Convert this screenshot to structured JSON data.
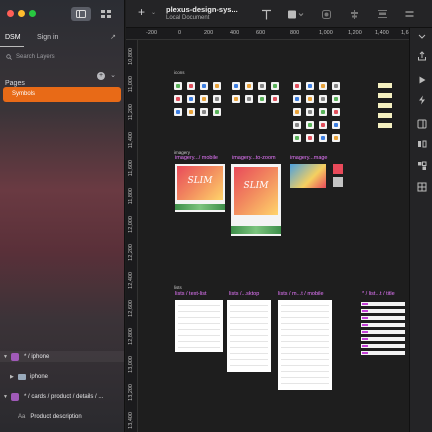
{
  "window": {
    "traffic_lights": [
      "#ff5f57",
      "#febc2e",
      "#28c840"
    ]
  },
  "sidebar": {
    "tabs": [
      "DSM",
      "Sign in"
    ],
    "search_placeholder": "Search Layers",
    "pages_label": "Pages",
    "selected_page": "Symbols",
    "accent": "#e86a17",
    "layers": [
      {
        "name": "* / iphone",
        "kind": "symbol"
      },
      {
        "name": "iphone",
        "kind": "folder"
      },
      {
        "name": "* / cards / product / details / ...",
        "kind": "symbol"
      },
      {
        "name": "Product description",
        "kind": "text"
      }
    ]
  },
  "toolbar": {
    "doc_title": "plexus-design-sys...",
    "doc_subtitle": "Local Document"
  },
  "ruler": {
    "x": [
      "-200",
      "0",
      "200",
      "400",
      "600",
      "800",
      "1,000",
      "1,200",
      "1,400",
      "1,6"
    ],
    "y": [
      "10,800",
      "11,000",
      "11,200",
      "11,400",
      "11,600",
      "11,800",
      "12,000",
      "12,200",
      "12,400",
      "12,600",
      "12,800",
      "13,000",
      "13,200",
      "13,400"
    ]
  },
  "canvas": {
    "icons_label": "icons",
    "imagery_label": "imagery",
    "imagery_titles": [
      "imagery.../ mobile",
      "imagery...to-zoom",
      "imagery...mage"
    ],
    "hero_text": "SLIM",
    "lists_label": "lists",
    "list_titles": [
      "lists / text-list",
      "lists /...sktop",
      "lists / m...t / mobile",
      "* / list...t / title"
    ]
  }
}
